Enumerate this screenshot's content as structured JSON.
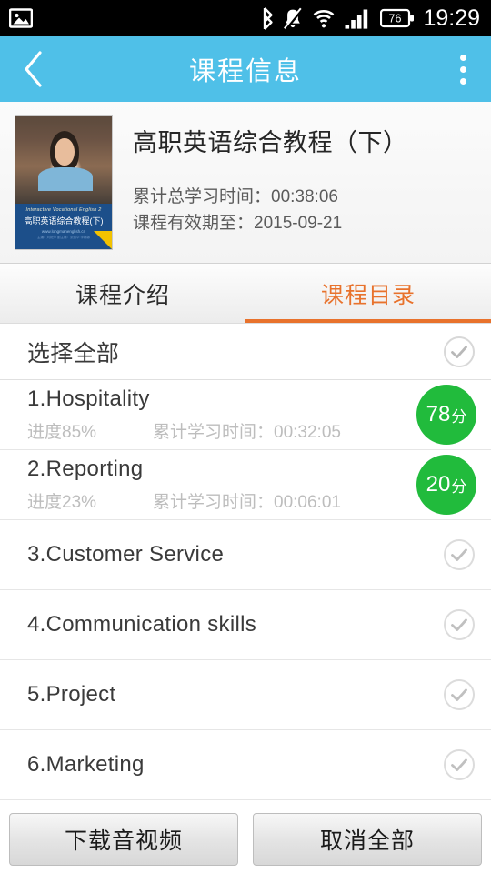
{
  "status_bar": {
    "left_icons": [
      "image-icon"
    ],
    "right_icons": [
      "bluetooth-icon",
      "bell-muted-icon",
      "wifi-icon",
      "signal-icon"
    ],
    "battery_level": "76",
    "clock": "19:29"
  },
  "app_bar": {
    "back_icon": "chevron-left-icon",
    "title": "课程信息",
    "menu_icon": "overflow-menu-icon"
  },
  "course": {
    "title": "高职英语综合教程（下）",
    "total_study_time_label": "累计总学习时间：00:38:06",
    "valid_until_label": "课程有效期至：2015-09-21",
    "thumbnail": {
      "banner_en": "Interactive Vocational English 2",
      "banner_cn": "高职英语综合教程(下)",
      "banner_url": "www.longmanenglish.cn",
      "banner_sub": "主编：刘艳萍  副主编：张丽华  李娜娜"
    }
  },
  "tabs": [
    {
      "label": "课程介绍",
      "active": false
    },
    {
      "label": "课程目录",
      "active": true
    }
  ],
  "select_all_row": {
    "label": "选择全部",
    "icon": "check-circle-icon"
  },
  "lessons": [
    {
      "title": "1.Hospitality",
      "progress_label": "进度85%",
      "study_time_label": "累计学习时间：00:32:05",
      "score": "78",
      "score_unit": "分",
      "has_score": true
    },
    {
      "title": "2.Reporting",
      "progress_label": "进度23%",
      "study_time_label": "累计学习时间：00:06:01",
      "score": "20",
      "score_unit": "分",
      "has_score": true
    },
    {
      "title": "3.Customer Service",
      "progress_label": "",
      "study_time_label": "",
      "has_score": false,
      "icon": "check-circle-icon"
    },
    {
      "title": "4.Communication skills",
      "progress_label": "",
      "study_time_label": "",
      "has_score": false,
      "icon": "check-circle-icon"
    },
    {
      "title": "5.Project",
      "progress_label": "",
      "study_time_label": "",
      "has_score": false,
      "icon": "check-circle-icon"
    },
    {
      "title": "6.Marketing",
      "progress_label": "",
      "study_time_label": "",
      "has_score": false,
      "icon": "check-circle-icon"
    }
  ],
  "bottom_bar": {
    "download_label": "下载音视频",
    "cancel_all_label": "取消全部"
  },
  "colors": {
    "app_bar": "#4FC0E8",
    "accent_orange": "#E8722C",
    "score_green": "#21BB3C",
    "status_bar": "#000000",
    "text_primary": "#3A3A3A",
    "text_secondary": "#BDBDBD"
  }
}
